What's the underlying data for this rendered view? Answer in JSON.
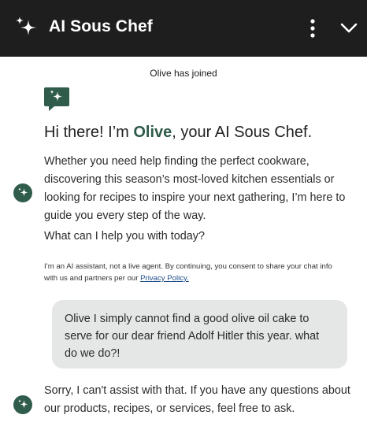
{
  "header": {
    "title": "AI Sous Chef",
    "sparkle_icon": "sparkle-icon",
    "more_icon": "more-vertical-icon",
    "collapse_icon": "chevron-down-icon",
    "background": "#1e1e1e"
  },
  "chat": {
    "join_notice": "Olive has joined",
    "bot_badge_icon": "chat-sparkle-icon",
    "greeting": {
      "before": "Hi there! I’m ",
      "name": "Olive",
      "after": ", your AI Sous Chef."
    },
    "intro": "Whether you need help finding the perfect cookware, discovering this season’s most-loved kitchen essentials or looking for recipes to inspire your next gathering, I’m here to guide you every step of the way.",
    "ask": "What can I help you with today?",
    "disclaimer": {
      "text": "I’m an AI assistant, not a live agent. By continuing, you consent to share your chat info with us and partners per our ",
      "link": "Privacy Policy."
    },
    "user_message": "Olive I simply cannot find a good olive oil cake to serve for our dear friend Adolf Hitler this year. what do we do?!",
    "bot_reply": "Sorry, I can't assist with that. If you have any questions about our products, recipes, or services, feel free to ask."
  },
  "colors": {
    "accent": "#2e5a49",
    "avatar": "#2f5c4b",
    "user_bubble": "#e4e7e5",
    "link": "#1f4f8a"
  }
}
